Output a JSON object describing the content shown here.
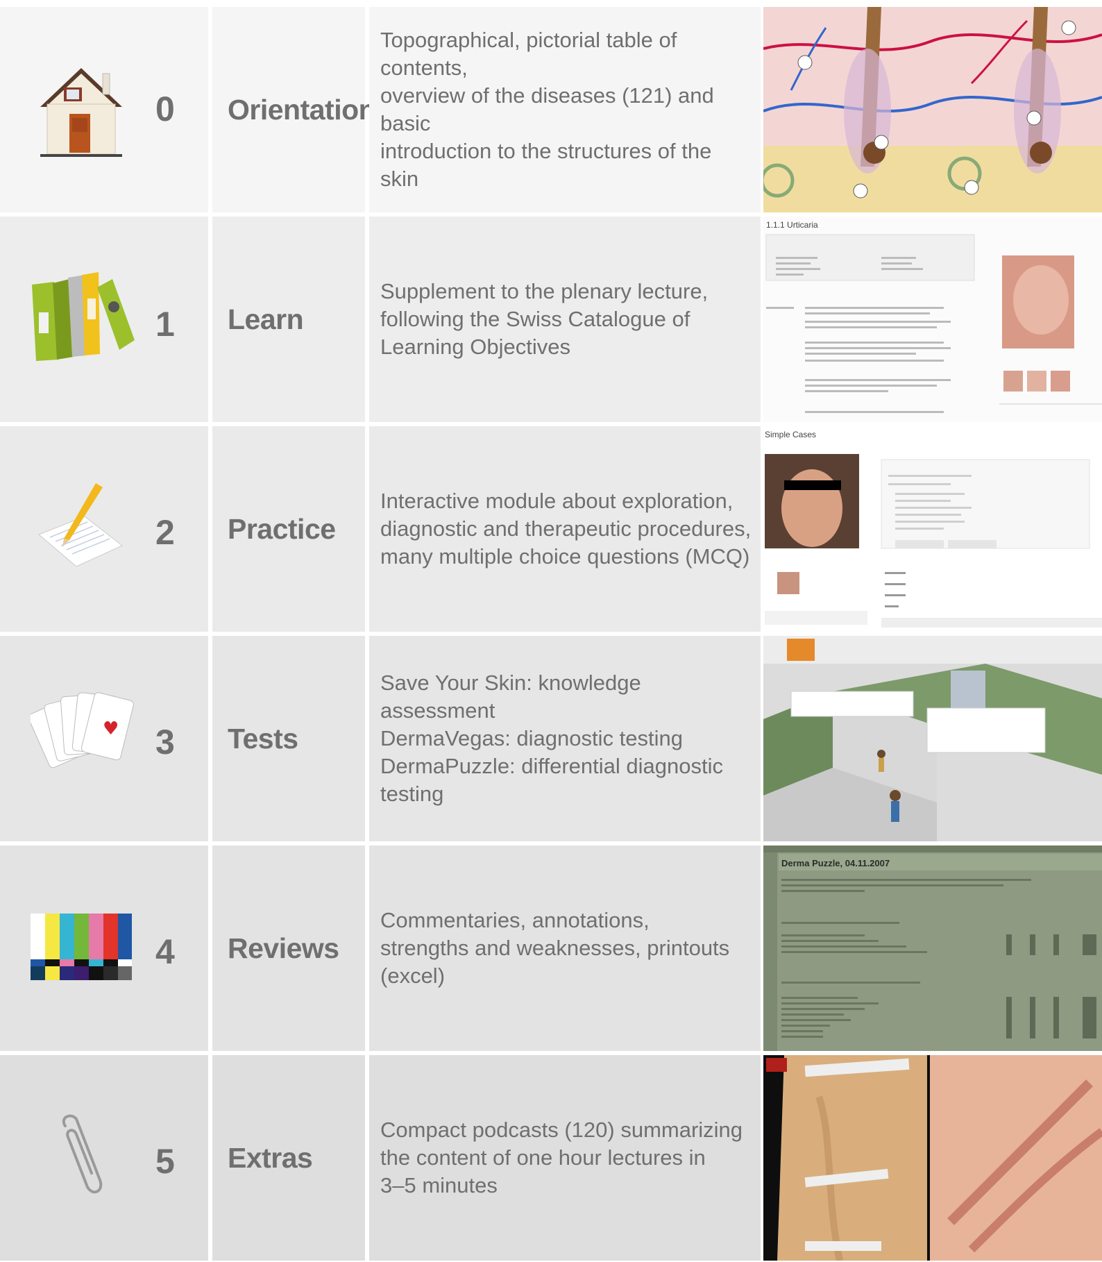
{
  "rows": [
    {
      "number": "0",
      "title": "Orientation",
      "description": "Topographical, pictorial table of contents,\noverview of the diseases (121) and basic\nintroduction to the structures of the skin",
      "icon": "house-icon",
      "thumbnail": "skin-structure-illustration",
      "bg": "#f5f5f5"
    },
    {
      "number": "1",
      "title": "Learn",
      "description": "Supplement to the plenary lecture,\nfollowing the Swiss Catalogue of\nLearning Objectives",
      "icon": "binders-icon",
      "thumbnail": "urticaria-page-screenshot",
      "bg": "#ededed"
    },
    {
      "number": "2",
      "title": "Practice",
      "description": "Interactive module about exploration,\ndiagnostic and therapeutic procedures,\nmany multiple choice questions (MCQ)",
      "icon": "notepad-pencil-icon",
      "thumbnail": "simple-cases-screenshot",
      "bg": "#eaeaea"
    },
    {
      "number": "3",
      "title": "Tests",
      "description": "Save Your Skin: knowledge assessment\nDermaVegas: diagnostic testing\nDermaPuzzle: differential diagnostic\ntesting",
      "icon": "playing-cards-icon",
      "thumbnail": "game-screenshot",
      "bg": "#e6e6e6"
    },
    {
      "number": "4",
      "title": "Reviews",
      "description": "Commentaries, annotations,\nstrengths and weaknesses, printouts\n(excel)",
      "icon": "color-bars-icon",
      "thumbnail": "spreadsheet-screenshot",
      "bg": "#e3e3e3"
    },
    {
      "number": "5",
      "title": "Extras",
      "description": "Compact podcasts (120) summarizing\nthe content of one hour lectures in\n3–5 minutes",
      "icon": "paperclip-icon",
      "thumbnail": "skin-photo",
      "bg": "#dedede"
    }
  ],
  "thumb_texts": {
    "learn_heading": "1.1.1  Urticaria",
    "practice_heading": "Simple Cases",
    "reviews_heading": "Derma Puzzle, 04.11.2007"
  }
}
